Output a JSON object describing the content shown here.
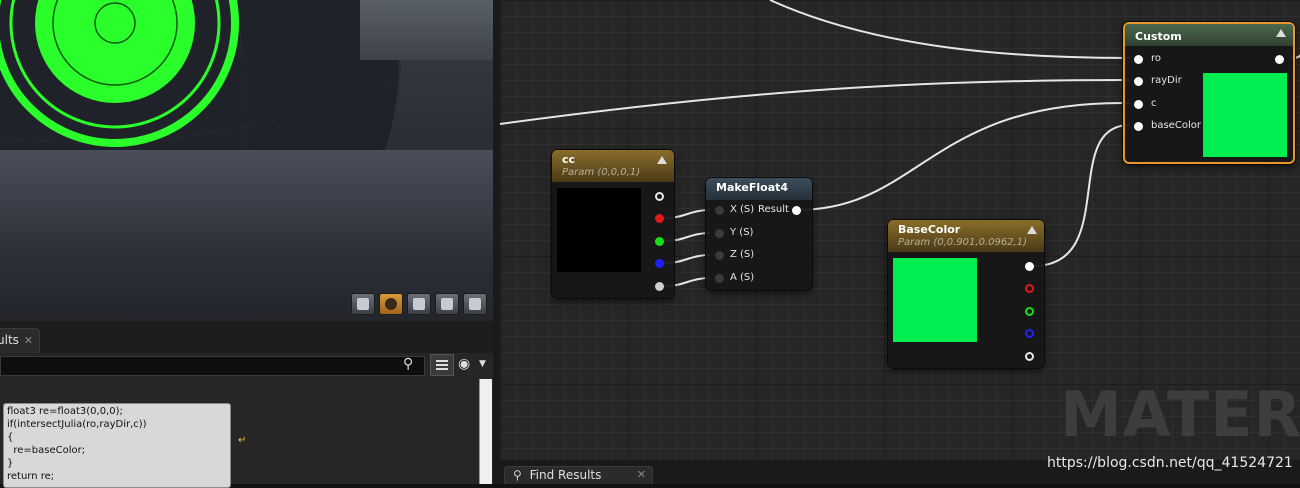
{
  "viewport": {
    "toolbar_icons": [
      "cylinder-icon",
      "sphere-icon",
      "plane-icon",
      "cube-icon",
      "teapot-icon"
    ]
  },
  "graph": {
    "watermark": "MATERIAL",
    "nodes": {
      "cc": {
        "title": "cc",
        "subtitle": "Param (0,0,0,1)",
        "preview_color": "#000000"
      },
      "makefloat4": {
        "title": "MakeFloat4",
        "inputs": [
          "X (S)",
          "Y (S)",
          "Z (S)",
          "A (S)"
        ],
        "output": "Result"
      },
      "basecolor": {
        "title": "BaseColor",
        "subtitle": "Param (0,0.901,0.0962,1)",
        "preview_color": "#00e84f"
      },
      "custom": {
        "title": "Custom",
        "inputs": [
          "ro",
          "rayDir",
          "c",
          "baseColor"
        ],
        "preview_color": "#00e84f"
      }
    }
  },
  "left_panel": {
    "tab_label": "ults",
    "search_placeholder": "",
    "code_lines": [
      "float3 re=float3(0,0,0);",
      "if(intersectJulia(ro,rayDir,c))",
      "{",
      "  re=baseColor;",
      "}",
      "return re;"
    ]
  },
  "bottom": {
    "find_results_tab": "Find Results",
    "watermark_url": "https://blog.csdn.net/qq_41524721"
  },
  "colors": {
    "accent_orange": "#e8962a",
    "preview_green": "#00e84f"
  }
}
